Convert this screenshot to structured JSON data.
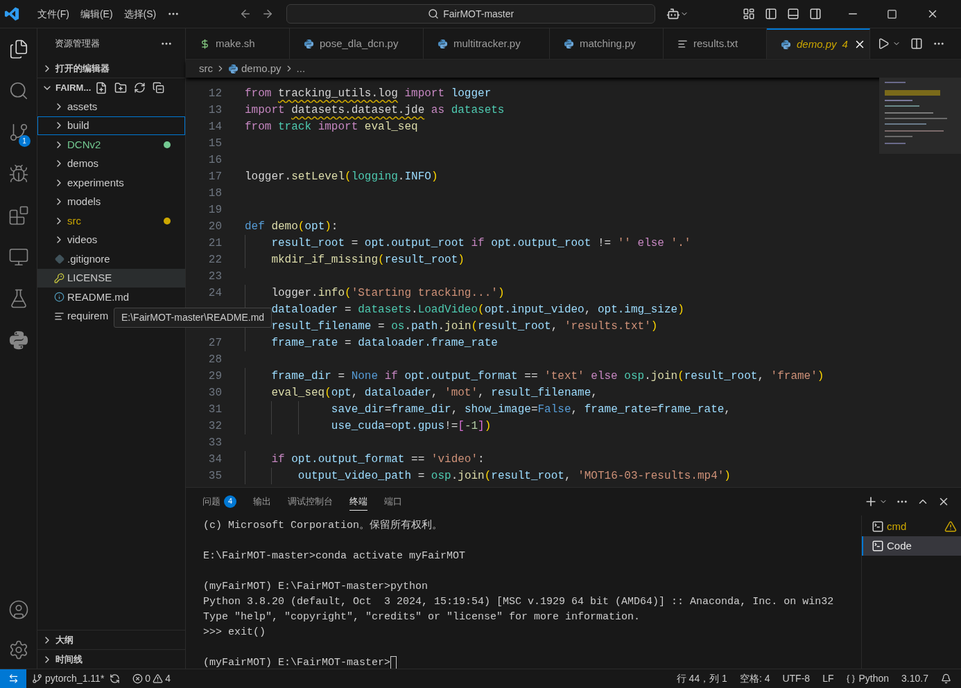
{
  "title_bar": {
    "menu": [
      "文件(F)",
      "编辑(E)",
      "选择(S)"
    ],
    "search": {
      "value": "FairMOT-master"
    }
  },
  "activity_bar": {
    "items": [
      {
        "kind": "explorer",
        "selected": true
      },
      {
        "kind": "search",
        "selected": false
      },
      {
        "kind": "source-control",
        "selected": false,
        "badge": "1"
      },
      {
        "kind": "run",
        "selected": false
      },
      {
        "kind": "extensions",
        "selected": false
      },
      {
        "kind": "remote",
        "selected": false
      },
      {
        "kind": "testing",
        "selected": false
      },
      {
        "kind": "python",
        "selected": false
      }
    ],
    "bottom": [
      {
        "kind": "account"
      },
      {
        "kind": "settings"
      }
    ]
  },
  "sidebar": {
    "title": "资源管理器",
    "open_editors": {
      "label": "打开的编辑器",
      "expanded": false
    },
    "folder": {
      "label": "FAIRM...",
      "expanded": true,
      "items": [
        {
          "label": "assets",
          "kind": "folder",
          "selected": false,
          "focused": false
        },
        {
          "label": "build",
          "kind": "folder",
          "selected": false,
          "focused": true
        },
        {
          "label": "DCNv2",
          "kind": "folder",
          "selected": false,
          "focused": false,
          "color": "#73c991"
        },
        {
          "label": "demos",
          "kind": "folder",
          "selected": false,
          "focused": false
        },
        {
          "label": "experiments",
          "kind": "folder",
          "selected": false,
          "focused": false
        },
        {
          "label": "models",
          "kind": "folder",
          "selected": false,
          "focused": false
        },
        {
          "label": "src",
          "kind": "folder",
          "selected": false,
          "focused": false,
          "color": "#cca700"
        },
        {
          "label": "videos",
          "kind": "folder",
          "selected": false,
          "focused": false
        },
        {
          "label": ".gitignore",
          "kind": "git",
          "selected": false,
          "focused": false
        },
        {
          "label": "LICENSE",
          "kind": "license",
          "selected": true,
          "focused": false
        },
        {
          "label": "README.md",
          "kind": "info",
          "selected": false,
          "focused": false
        },
        {
          "label": "requirem",
          "kind": "text",
          "selected": false,
          "focused": false
        }
      ]
    },
    "outline": {
      "label": "大纲",
      "expanded": false
    },
    "timeline": {
      "label": "时间线",
      "expanded": false
    }
  },
  "tooltip": {
    "text": "E:\\FairMOT-master\\README.md"
  },
  "editor_tabs": [
    {
      "label": "make.sh",
      "kind": "shell",
      "selected": false
    },
    {
      "label": "pose_dla_dcn.py",
      "kind": "python",
      "selected": false
    },
    {
      "label": "multitracker.py",
      "kind": "python",
      "selected": false
    },
    {
      "label": "matching.py",
      "kind": "python",
      "selected": false
    },
    {
      "label": "results.txt",
      "kind": "text",
      "selected": false
    },
    {
      "label": "demo.py",
      "kind": "python",
      "selected": true,
      "problems": "4"
    }
  ],
  "breadcrumb": [
    {
      "label": "src",
      "kind": "folder"
    },
    {
      "label": "demo.py",
      "kind": "python"
    },
    {
      "label": "...",
      "kind": "more"
    }
  ],
  "code": [
    {
      "number": "12",
      "tokens": [
        {
          "kind": "kw",
          "text": "from "
        },
        {
          "kind": "plain",
          "text": "tracking_utils.log",
          "warning": true
        },
        {
          "kind": "kw",
          "text": " import "
        },
        {
          "kind": "var",
          "text": "logger"
        }
      ]
    },
    {
      "number": "13",
      "tokens": [
        {
          "kind": "kw",
          "text": "import "
        },
        {
          "kind": "plain",
          "text": "datasets.dataset.jde",
          "warning": true
        },
        {
          "kind": "kw",
          "text": " as "
        },
        {
          "kind": "mod",
          "text": "datasets"
        }
      ]
    },
    {
      "number": "14",
      "tokens": [
        {
          "kind": "kw",
          "text": "from "
        },
        {
          "kind": "mod",
          "text": "track"
        },
        {
          "kind": "kw",
          "text": " import "
        },
        {
          "kind": "fn",
          "text": "eval_seq"
        }
      ]
    },
    {
      "number": "15"
    },
    {
      "number": "16"
    },
    {
      "number": "17",
      "tokens": [
        {
          "kind": "plain",
          "text": "logger."
        },
        {
          "kind": "fn",
          "text": "setLevel"
        },
        {
          "kind": "brk1",
          "text": "("
        },
        {
          "kind": "mod",
          "text": "logging"
        },
        {
          "kind": "plain",
          "text": "."
        },
        {
          "kind": "var",
          "text": "INFO"
        },
        {
          "kind": "brk1",
          "text": ")"
        }
      ]
    },
    {
      "number": "18"
    },
    {
      "number": "19"
    },
    {
      "number": "20",
      "tokens": [
        {
          "kind": "storage",
          "text": "def "
        },
        {
          "kind": "fn",
          "text": "demo"
        },
        {
          "kind": "brk1",
          "text": "("
        },
        {
          "kind": "var",
          "text": "opt"
        },
        {
          "kind": "brk1",
          "text": ")"
        },
        {
          "kind": "plain",
          "text": ":"
        }
      ]
    },
    {
      "number": "21",
      "tokens": [
        {
          "kind": "var",
          "text": "    result_root"
        },
        {
          "kind": "plain",
          "text": " = "
        },
        {
          "kind": "var",
          "text": "opt.output_root"
        },
        {
          "kind": "kw",
          "text": " if "
        },
        {
          "kind": "var",
          "text": "opt.output_root"
        },
        {
          "kind": "plain",
          "text": " != "
        },
        {
          "kind": "str",
          "text": "''"
        },
        {
          "kind": "kw",
          "text": " else "
        },
        {
          "kind": "str",
          "text": "'.'"
        }
      ]
    },
    {
      "number": "22",
      "tokens": [
        {
          "kind": "fn",
          "text": "    mkdir_if_missing"
        },
        {
          "kind": "brk1",
          "text": "("
        },
        {
          "kind": "var",
          "text": "result_root"
        },
        {
          "kind": "brk1",
          "text": ")"
        }
      ]
    },
    {
      "number": "23"
    },
    {
      "number": "24",
      "tokens": [
        {
          "kind": "plain",
          "text": "    logger."
        },
        {
          "kind": "fn",
          "text": "info"
        },
        {
          "kind": "brk1",
          "text": "("
        },
        {
          "kind": "str",
          "text": "'Starting tracking...'"
        },
        {
          "kind": "brk1",
          "text": ")"
        }
      ]
    },
    {
      "tokens": [
        {
          "kind": "var",
          "text": "    dataloader"
        },
        {
          "kind": "plain",
          "text": " = "
        },
        {
          "kind": "mod",
          "text": "datasets"
        },
        {
          "kind": "plain",
          "text": "."
        },
        {
          "kind": "mod",
          "text": "LoadVideo"
        },
        {
          "kind": "brk1",
          "text": "("
        },
        {
          "kind": "var",
          "text": "opt.input_video"
        },
        {
          "kind": "plain",
          "text": ", "
        },
        {
          "kind": "var",
          "text": "opt.img_size"
        },
        {
          "kind": "brk1",
          "text": ")"
        }
      ]
    },
    {
      "tokens": [
        {
          "kind": "var",
          "text": "    result_filename"
        },
        {
          "kind": "plain",
          "text": " = "
        },
        {
          "kind": "mod",
          "text": "os"
        },
        {
          "kind": "plain",
          "text": "."
        },
        {
          "kind": "var",
          "text": "path"
        },
        {
          "kind": "plain",
          "text": "."
        },
        {
          "kind": "fn",
          "text": "join"
        },
        {
          "kind": "brk1",
          "text": "("
        },
        {
          "kind": "var",
          "text": "result_root"
        },
        {
          "kind": "plain",
          "text": ", "
        },
        {
          "kind": "str",
          "text": "'results.txt'"
        },
        {
          "kind": "brk1",
          "text": ")"
        }
      ]
    },
    {
      "number": "27",
      "tokens": [
        {
          "kind": "var",
          "text": "    frame_rate"
        },
        {
          "kind": "plain",
          "text": " = "
        },
        {
          "kind": "var",
          "text": "dataloader.frame_rate"
        }
      ]
    },
    {
      "number": "28"
    },
    {
      "number": "29",
      "tokens": [
        {
          "kind": "var",
          "text": "    frame_dir"
        },
        {
          "kind": "plain",
          "text": " = "
        },
        {
          "kind": "storage",
          "text": "None"
        },
        {
          "kind": "kw",
          "text": " if "
        },
        {
          "kind": "var",
          "text": "opt.output_format"
        },
        {
          "kind": "plain",
          "text": " == "
        },
        {
          "kind": "str",
          "text": "'text'"
        },
        {
          "kind": "kw",
          "text": " else "
        },
        {
          "kind": "mod",
          "text": "osp"
        },
        {
          "kind": "plain",
          "text": "."
        },
        {
          "kind": "fn",
          "text": "join"
        },
        {
          "kind": "brk1",
          "text": "("
        },
        {
          "kind": "var",
          "text": "result_root"
        },
        {
          "kind": "plain",
          "text": ", "
        },
        {
          "kind": "str",
          "text": "'frame'"
        },
        {
          "kind": "brk1",
          "text": ")"
        }
      ]
    },
    {
      "number": "30",
      "tokens": [
        {
          "kind": "fn",
          "text": "    eval_seq"
        },
        {
          "kind": "brk1",
          "text": "("
        },
        {
          "kind": "var",
          "text": "opt"
        },
        {
          "kind": "plain",
          "text": ", "
        },
        {
          "kind": "var",
          "text": "dataloader"
        },
        {
          "kind": "plain",
          "text": ", "
        },
        {
          "kind": "str",
          "text": "'mot'"
        },
        {
          "kind": "plain",
          "text": ", "
        },
        {
          "kind": "var",
          "text": "result_filename"
        },
        {
          "kind": "plain",
          "text": ","
        }
      ]
    },
    {
      "number": "31",
      "tokens": [
        {
          "kind": "var",
          "text": "             save_dir"
        },
        {
          "kind": "plain",
          "text": "="
        },
        {
          "kind": "var",
          "text": "frame_dir"
        },
        {
          "kind": "plain",
          "text": ", "
        },
        {
          "kind": "var",
          "text": "show_image"
        },
        {
          "kind": "plain",
          "text": "="
        },
        {
          "kind": "storage",
          "text": "False"
        },
        {
          "kind": "plain",
          "text": ", "
        },
        {
          "kind": "var",
          "text": "frame_rate"
        },
        {
          "kind": "plain",
          "text": "="
        },
        {
          "kind": "var",
          "text": "frame_rate"
        },
        {
          "kind": "plain",
          "text": ","
        }
      ]
    },
    {
      "number": "32",
      "tokens": [
        {
          "kind": "var",
          "text": "             use_cuda"
        },
        {
          "kind": "plain",
          "text": "="
        },
        {
          "kind": "var",
          "text": "opt.gpus"
        },
        {
          "kind": "plain",
          "text": "!="
        },
        {
          "kind": "brk2",
          "text": "["
        },
        {
          "kind": "num",
          "text": "-1"
        },
        {
          "kind": "brk2",
          "text": "]"
        },
        {
          "kind": "brk1",
          "text": ")"
        }
      ]
    },
    {
      "number": "33"
    },
    {
      "number": "34",
      "tokens": [
        {
          "kind": "kw",
          "text": "    if "
        },
        {
          "kind": "var",
          "text": "opt.output_format"
        },
        {
          "kind": "plain",
          "text": " == "
        },
        {
          "kind": "str",
          "text": "'video'"
        },
        {
          "kind": "plain",
          "text": ":"
        }
      ]
    },
    {
      "number": "35",
      "tokens": [
        {
          "kind": "var",
          "text": "        output_video_path"
        },
        {
          "kind": "plain",
          "text": " = "
        },
        {
          "kind": "mod",
          "text": "osp"
        },
        {
          "kind": "plain",
          "text": "."
        },
        {
          "kind": "fn",
          "text": "join"
        },
        {
          "kind": "brk1",
          "text": "("
        },
        {
          "kind": "var",
          "text": "result_root"
        },
        {
          "kind": "plain",
          "text": ", "
        },
        {
          "kind": "str",
          "text": "'MOT16-03-results.mp4'"
        },
        {
          "kind": "brk1",
          "text": ")"
        }
      ]
    }
  ],
  "panel": {
    "tabs": [
      {
        "label": "问题",
        "badge": "4",
        "selected": false
      },
      {
        "label": "输出",
        "selected": false
      },
      {
        "label": "调试控制台",
        "selected": false
      },
      {
        "label": "终端",
        "selected": true
      },
      {
        "label": "端口",
        "selected": false
      }
    ],
    "terminal": {
      "blocks": [
        [
          "(c) Microsoft Corporation。保留所有权利。"
        ],
        [
          "E:\\FairMOT-master>conda activate myFairMOT"
        ],
        [
          "(myFairMOT) E:\\FairMOT-master>python",
          "Python 3.8.20 (default, Oct  3 2024, 15:19:54) [MSC v.1929 64 bit (AMD64)] :: Anaconda, Inc. on win32",
          "Type \"help\", \"copyright\", \"credits\" or \"license\" for more information.",
          ">>> exit()"
        ],
        [
          "(myFairMOT) E:\\FairMOT-master>"
        ]
      ]
    },
    "terminals": [
      {
        "label": "cmd",
        "selected": false,
        "warning": true
      },
      {
        "label": "Code",
        "selected": true,
        "warning": false
      }
    ]
  },
  "status_bar": {
    "branch": "pytorch_1.11*",
    "errors": "0",
    "warnings": "4",
    "right": [
      {
        "kind": "text",
        "text": "行 44，列 1"
      },
      {
        "kind": "text",
        "text": "空格: 4"
      },
      {
        "kind": "text",
        "text": "UTF-8"
      },
      {
        "kind": "text",
        "text": "LF"
      },
      {
        "kind": "language",
        "text": "Python"
      },
      {
        "kind": "text",
        "text": "3.10.7"
      }
    ]
  }
}
